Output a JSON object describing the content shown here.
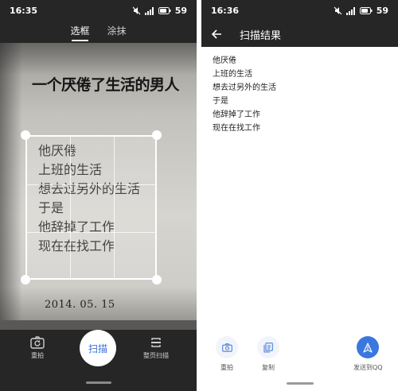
{
  "left": {
    "status": {
      "time": "16:35",
      "battery": "59"
    },
    "tabs": [
      {
        "label": "选框",
        "active": true
      },
      {
        "label": "涂抹",
        "active": false
      }
    ],
    "document": {
      "title": "一个厌倦了生活的男人",
      "lines": [
        "他厌倦",
        "上班的生活",
        "想去过另外的生活",
        "于是",
        "他辞掉了工作",
        "现在在找工作"
      ],
      "date": "2014. 05. 15"
    },
    "bottom": {
      "retake_label": "重拍",
      "scan_label": "扫描",
      "full_page_label": "整页扫描"
    }
  },
  "right": {
    "status": {
      "time": "16:36",
      "battery": "59"
    },
    "title": "扫描结果",
    "result_lines": [
      "他厌倦",
      "上班的生活",
      "想去过另外的生活",
      "于是",
      "他辞掉了工作",
      "现在在找工作"
    ],
    "actions": {
      "retake_label": "重拍",
      "copy_label": "复制",
      "send_label": "发送到QQ"
    }
  },
  "colors": {
    "accent": "#3a78e0",
    "dark": "#262626"
  },
  "icons": [
    "mute-icon",
    "signal-icon",
    "battery-icon",
    "back-arrow-icon",
    "camera-retake-icon",
    "full-page-scan-icon",
    "copy-icon",
    "send-icon"
  ]
}
